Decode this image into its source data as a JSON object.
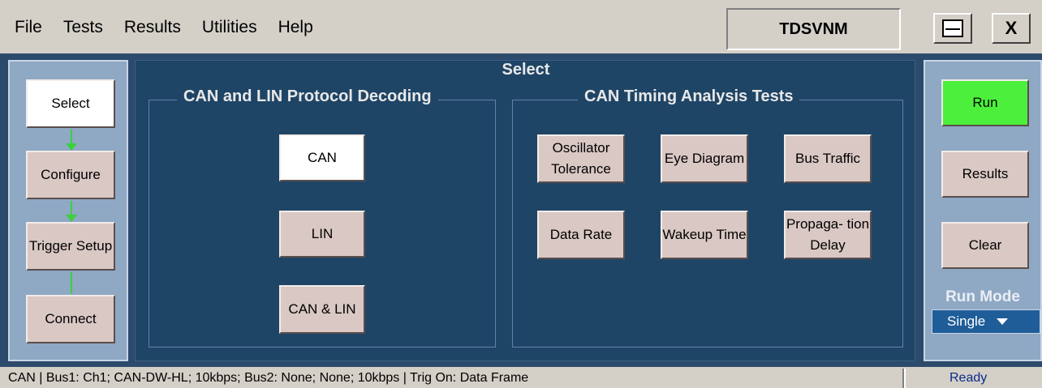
{
  "menu": {
    "file": "File",
    "tests": "Tests",
    "results": "Results",
    "utilities": "Utilities",
    "help": "Help"
  },
  "app_title": "TDSVNM",
  "window_controls": {
    "close": "X"
  },
  "nav": {
    "select": "Select",
    "configure": "Configure",
    "trigger_setup": "Trigger Setup",
    "connect": "Connect"
  },
  "main": {
    "title": "Select",
    "protocol_group": {
      "label": "CAN and LIN Protocol Decoding",
      "buttons": {
        "can": "CAN",
        "lin": "LIN",
        "can_lin": "CAN & LIN"
      }
    },
    "timing_group": {
      "label": "CAN Timing Analysis Tests",
      "buttons": {
        "oscillator": "Oscillator Tolerance",
        "eye": "Eye Diagram",
        "bus": "Bus Traffic",
        "data_rate": "Data Rate",
        "wakeup": "Wakeup Time",
        "propagation": "Propaga- tion Delay"
      }
    }
  },
  "right": {
    "run": "Run",
    "results": "Results",
    "clear": "Clear",
    "run_mode_label": "Run Mode",
    "run_mode_value": "Single"
  },
  "status": {
    "text": "CAN  |  Bus1: Ch1; CAN-DW-HL; 10kbps; Bus2: None; None; 10kbps  |  Trig On: Data Frame",
    "ready": "Ready"
  },
  "colors": {
    "run_button": "#4cf03c",
    "main_bg": "#1f4566",
    "panel_bg": "#8fa8c4"
  }
}
